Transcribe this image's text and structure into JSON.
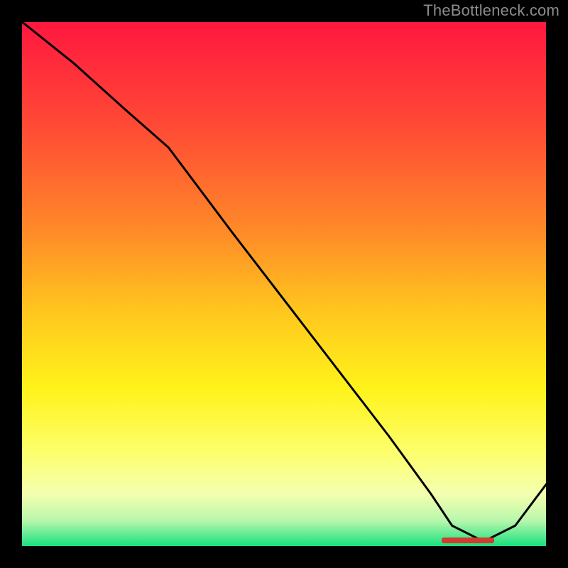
{
  "watermark": "TheBottleneck.com",
  "chart_data": {
    "type": "line",
    "title": "",
    "xlabel": "",
    "ylabel": "",
    "xlim": [
      0,
      100
    ],
    "ylim": [
      0,
      100
    ],
    "series": [
      {
        "name": "curve",
        "x": [
          0,
          10,
          20,
          28,
          40,
          50,
          60,
          70,
          78,
          82,
          88,
          94,
          100
        ],
        "y": [
          100,
          92,
          83,
          76,
          60,
          47,
          34,
          21,
          10,
          4,
          1,
          4,
          12
        ]
      }
    ],
    "gradient_stops": [
      {
        "offset": 0,
        "color": "#ff173f"
      },
      {
        "offset": 20,
        "color": "#ff4a35"
      },
      {
        "offset": 40,
        "color": "#ff8a28"
      },
      {
        "offset": 55,
        "color": "#ffc61e"
      },
      {
        "offset": 70,
        "color": "#fff31a"
      },
      {
        "offset": 82,
        "color": "#fdff6c"
      },
      {
        "offset": 90,
        "color": "#f4ffb0"
      },
      {
        "offset": 95,
        "color": "#b9f7ac"
      },
      {
        "offset": 100,
        "color": "#15e07e"
      }
    ],
    "segment_marker": {
      "x_start": 80,
      "x_end": 90,
      "y": 1.2
    },
    "colors": {
      "frame": "#000000",
      "line": "#000000",
      "marker": "#d33b2f",
      "watermark": "#8b8b8b"
    }
  }
}
